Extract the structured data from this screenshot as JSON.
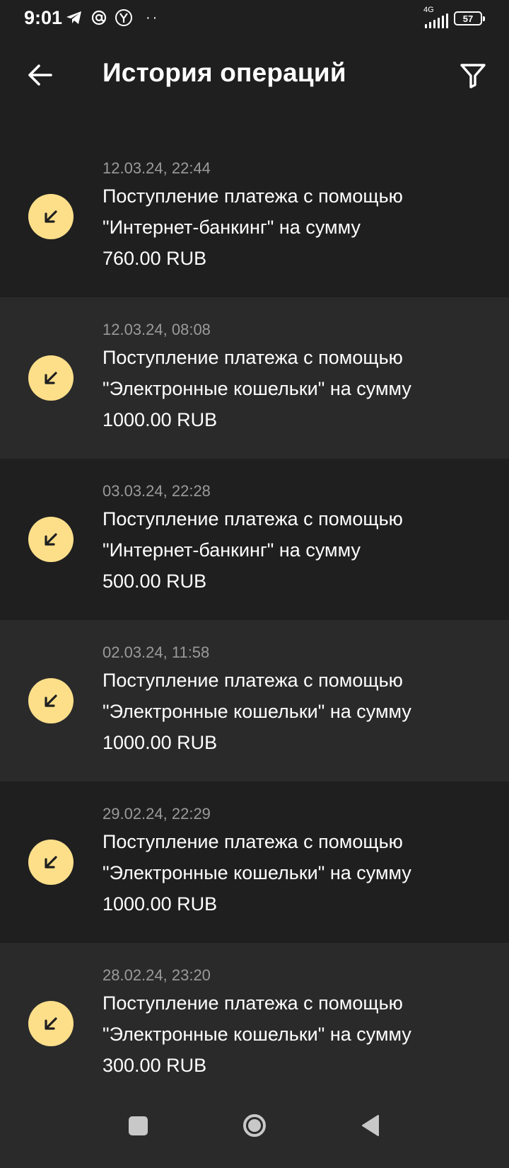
{
  "status_bar": {
    "time": "9:01",
    "network": "4G",
    "battery": "57",
    "left_icons": [
      "telegram-icon",
      "at-sign-icon",
      "yandex-icon",
      "more-dots-icon"
    ],
    "dots": "··"
  },
  "header": {
    "title": "История операций",
    "back_icon": "arrow-left-icon",
    "filter_icon": "filter-funnel-icon"
  },
  "colors": {
    "background": "#1f1f1f",
    "row_alt": "#2a2a2a",
    "icon_circle": "#fddf8a",
    "date_text": "#9a9a9a"
  },
  "operations": [
    {
      "date": "12.03.24, 22:44",
      "line1": "Поступление платежа с помощью",
      "line2": "\"Интернет-банкинг\" на сумму",
      "line3": "760.00 RUB",
      "icon": "incoming-arrow-icon"
    },
    {
      "date": "12.03.24, 08:08",
      "line1": "Поступление платежа с помощью",
      "line2": "\"Электронные кошельки\" на сумму",
      "line3": "1000.00 RUB",
      "icon": "incoming-arrow-icon"
    },
    {
      "date": "03.03.24, 22:28",
      "line1": "Поступление платежа с помощью",
      "line2": "\"Интернет-банкинг\" на сумму",
      "line3": "500.00 RUB",
      "icon": "incoming-arrow-icon"
    },
    {
      "date": "02.03.24, 11:58",
      "line1": "Поступление платежа с помощью",
      "line2": "\"Электронные кошельки\" на сумму",
      "line3": "1000.00 RUB",
      "icon": "incoming-arrow-icon"
    },
    {
      "date": "29.02.24, 22:29",
      "line1": "Поступление платежа с помощью",
      "line2": "\"Электронные кошельки\" на сумму",
      "line3": "1000.00 RUB",
      "icon": "incoming-arrow-icon"
    },
    {
      "date": "28.02.24, 23:20",
      "line1": "Поступление платежа с помощью",
      "line2": "\"Электронные кошельки\" на сумму",
      "line3": "300.00 RUB",
      "icon": "incoming-arrow-icon"
    }
  ],
  "nav_bar": {
    "buttons": [
      "recent-apps-square-icon",
      "home-circle-icon",
      "back-triangle-icon"
    ]
  }
}
